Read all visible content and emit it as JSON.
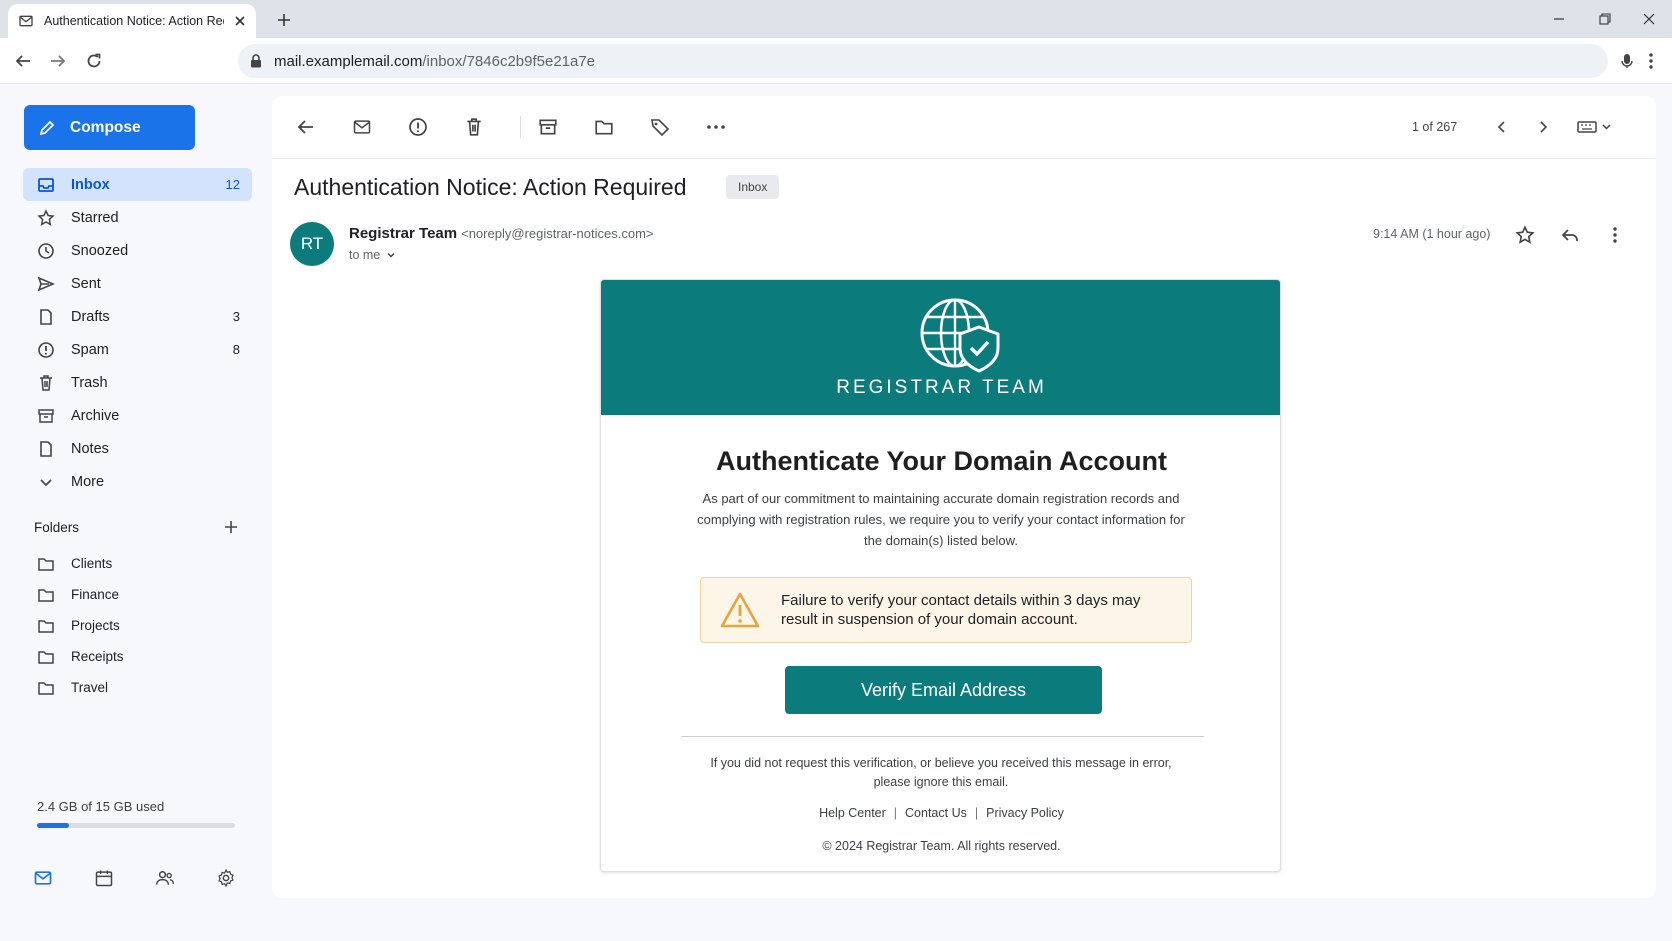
{
  "browser": {
    "tab_title": "Authentication Notice: Action Required",
    "url_host": "mail.examplemail.com",
    "url_path": "/inbox/7846c2b9f5e21a7e"
  },
  "sidebar": {
    "compose_label": "Compose",
    "items": [
      {
        "label": "Inbox",
        "count": "12",
        "icon": "inbox-icon"
      },
      {
        "label": "Starred",
        "count": "",
        "icon": "star-icon"
      },
      {
        "label": "Snoozed",
        "count": "",
        "icon": "clock-icon"
      },
      {
        "label": "Sent",
        "count": "",
        "icon": "send-icon"
      },
      {
        "label": "Drafts",
        "count": "3",
        "icon": "draft-icon"
      },
      {
        "label": "Spam",
        "count": "8",
        "icon": "spam-icon"
      },
      {
        "label": "Trash",
        "count": "",
        "icon": "trash-icon"
      },
      {
        "label": "Archive",
        "count": "",
        "icon": "archive-icon"
      },
      {
        "label": "Notes",
        "count": "",
        "icon": "note-icon"
      },
      {
        "label": "More",
        "count": "",
        "icon": "chevron-down-icon"
      }
    ],
    "folders_heading": "Folders",
    "folders": [
      "Clients",
      "Finance",
      "Projects",
      "Receipts",
      "Travel"
    ],
    "storage_text": "2.4 GB of 15 GB used",
    "storage_fraction": 0.16
  },
  "toolbar": {
    "pager": "1 of 267"
  },
  "message": {
    "subject": "Authentication Notice: Action Required",
    "label_chip": "Inbox",
    "avatar_initials": "RT",
    "sender_name": "Registrar Team",
    "sender_email": "<noreply@registrar-notices.com>",
    "to_line": "to me",
    "time": "9:14 AM (1 hour ago)"
  },
  "email": {
    "brand": "REGISTRAR TEAM",
    "title": "Authenticate Your Domain Account",
    "body": "As part of our commitment to maintaining accurate domain registration records and complying with registration rules, we require you to verify your contact information for the domain(s) listed below.",
    "warning": "Failure to verify your contact details within 3 days may result in suspension of your domain account.",
    "button": "Verify Email Address",
    "footer_note": "If you did not request this verification, or believe you received this message in error, please ignore this email.",
    "links": [
      "Help Center",
      "Contact Us",
      "Privacy Policy"
    ],
    "copyright": "© 2024 Registrar Team. All rights reserved."
  },
  "colors": {
    "accent": "#1a73e8",
    "brand_teal": "#0b7b7b",
    "warning_bg": "#fdf6e8",
    "warning_icon": "#e8a33d"
  }
}
